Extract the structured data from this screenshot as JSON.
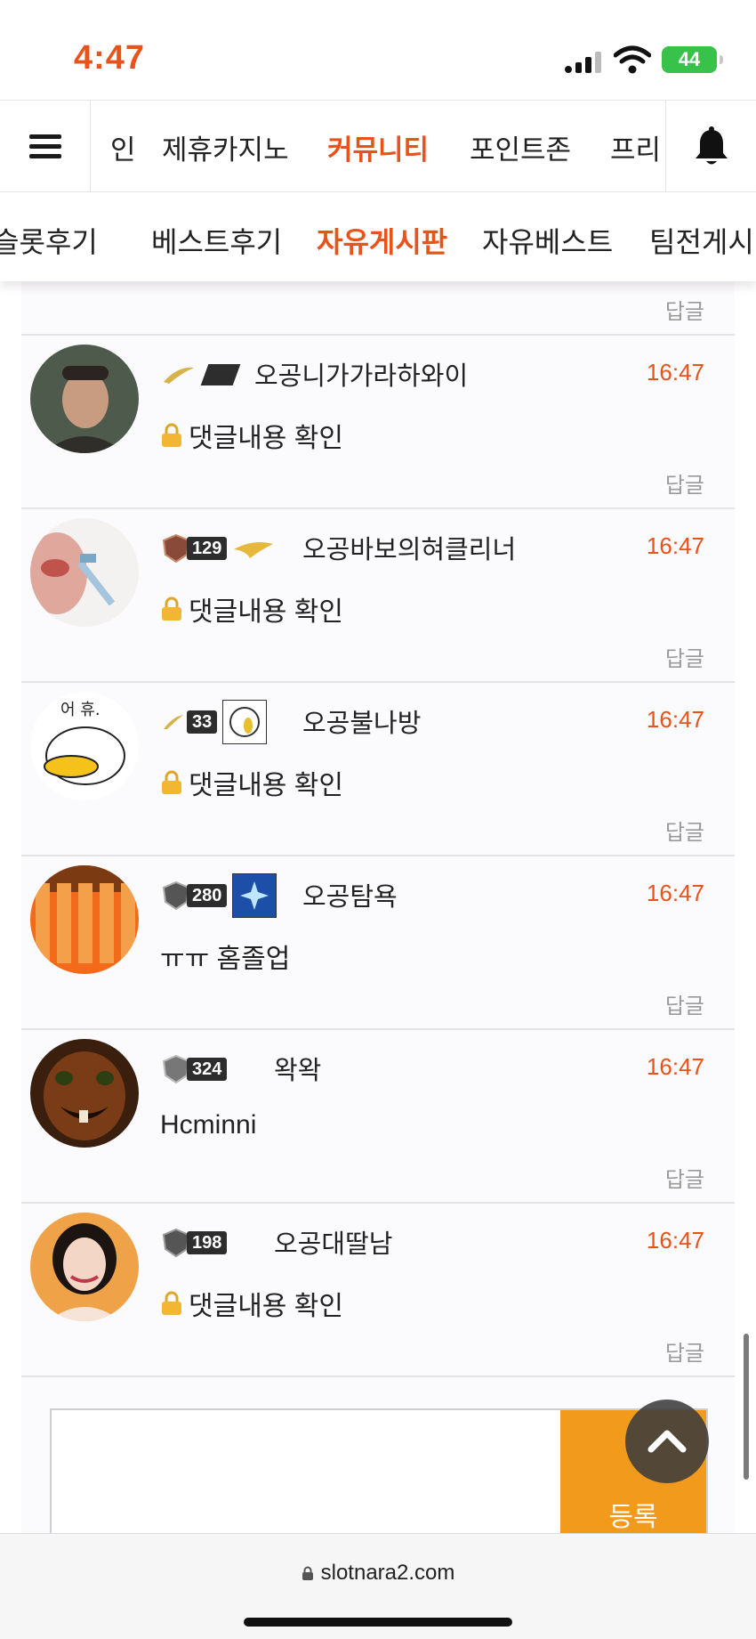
{
  "status_bar": {
    "time": "4:47",
    "battery": "44"
  },
  "top_nav": {
    "tabs": [
      {
        "label": "인",
        "active": false
      },
      {
        "label": "제휴카지노",
        "active": false
      },
      {
        "label": "커뮤니티",
        "active": true
      },
      {
        "label": "포인트존",
        "active": false
      },
      {
        "label": "프리",
        "active": false
      }
    ]
  },
  "sub_nav": {
    "tabs": [
      {
        "label": "슬롯후기",
        "active": false
      },
      {
        "label": "베스트후기",
        "active": false
      },
      {
        "label": "자유게시판",
        "active": true
      },
      {
        "label": "자유베스트",
        "active": false
      },
      {
        "label": "팀전게시",
        "active": false
      }
    ]
  },
  "comments_top_reply": "답글",
  "comments": [
    {
      "level": "",
      "nickname": "오공니가가라하와이",
      "time": "16:47",
      "content": "댓글내용 확인",
      "locked": true,
      "reply": "답글"
    },
    {
      "level": "129",
      "nickname": "오공바보의혀클리너",
      "time": "16:47",
      "content": "댓글내용 확인",
      "locked": true,
      "reply": "답글"
    },
    {
      "level": "33",
      "nickname": "오공불나방",
      "time": "16:47",
      "content": "댓글내용 확인",
      "locked": true,
      "reply": "답글"
    },
    {
      "level": "280",
      "nickname": "오공탐욕",
      "time": "16:47",
      "content": "ㅠㅠ 홈졸업",
      "locked": false,
      "reply": "답글"
    },
    {
      "level": "324",
      "nickname": "왁왁",
      "time": "16:47",
      "content": "Hcminni",
      "locked": false,
      "reply": "답글"
    },
    {
      "level": "198",
      "nickname": "오공대딸남",
      "time": "16:47",
      "content": "댓글내용 확인",
      "locked": true,
      "reply": "답글"
    }
  ],
  "editor": {
    "submit_label": "등록"
  },
  "url_bar": {
    "url": "slotnara2.com"
  },
  "colors": {
    "accent": "#e8531b",
    "submit": "#f29a1b"
  }
}
